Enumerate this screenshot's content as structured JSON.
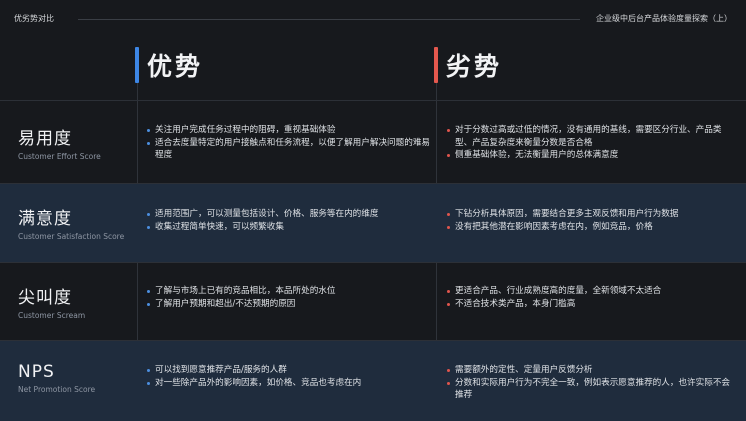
{
  "header": {
    "left_title": "优劣势对比",
    "right_title": "企业级中后台产品体验度量探索（上）"
  },
  "columns": {
    "advantages": "优势",
    "disadvantages": "劣势"
  },
  "colors": {
    "background": "#17191d",
    "alt_row": "#1f2c3d",
    "advantage_accent": "#3d86e5",
    "disadvantage_accent": "#e4584e"
  },
  "rows": [
    {
      "name": "易用度",
      "en": "Customer Effort Score",
      "pros": [
        "关注用户完成任务过程中的阻碍，重视基础体验",
        "适合去度量特定的用户接触点和任务流程，以便了解用户解决问题的难易程度"
      ],
      "cons": [
        "对于分数过高或过低的情况，没有通用的基线，需要区分行业、产品类型、产品复杂度来衡量分数是否合格",
        "侧重基础体验，无法衡量用户的总体满意度"
      ]
    },
    {
      "name": "满意度",
      "en": "Customer Satisfaction Score",
      "pros": [
        "适用范围广，可以测量包括设计、价格、服务等在内的维度",
        "收集过程简单快速，可以频繁收集"
      ],
      "cons": [
        "下钻分析具体原因，需要结合更多主观反馈和用户行为数据",
        "没有把其他潜在影响因素考虑在内，例如竞品，价格"
      ]
    },
    {
      "name": "尖叫度",
      "en": "Customer Scream",
      "pros": [
        "了解与市场上已有的竞品相比，本品所处的水位",
        "了解用户预期和超出/不达预期的原因"
      ],
      "cons": [
        "更适合产品、行业成熟度高的度量，全新领域不太适合",
        "不适合技术类产品，本身门槛高"
      ]
    },
    {
      "name": "NPS",
      "en": "Net Promotion Score",
      "pros": [
        "可以找到愿意推荐产品/服务的人群",
        "对一些除产品外的影响因素，如价格、竞品也考虑在内"
      ],
      "cons": [
        "需要额外的定性、定量用户反馈分析",
        "分数和实际用户行为不完全一致，例如表示愿意推荐的人，也许实际不会推荐"
      ]
    }
  ]
}
